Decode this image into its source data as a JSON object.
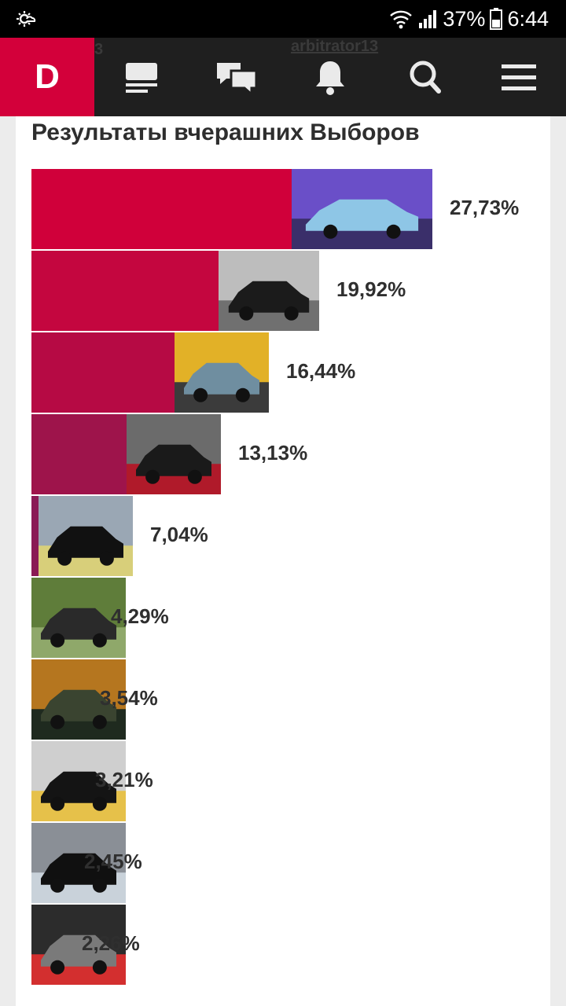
{
  "status_bar": {
    "battery": "37%",
    "time": "6:44"
  },
  "nav": {
    "logo": "D",
    "peek_user": "arbitrator13",
    "peek_num": "3",
    "icons": [
      "feed-icon",
      "messages-icon",
      "bell-icon",
      "search-icon",
      "menu-icon"
    ]
  },
  "chart_data": {
    "type": "bar",
    "orientation": "horizontal",
    "title": "Результаты вчерашних Выборов",
    "categories": [
      "",
      "",
      "",
      "",
      "",
      "",
      "",
      "",
      "",
      ""
    ],
    "values": [
      27.73,
      19.92,
      16.44,
      13.13,
      7.04,
      4.29,
      3.54,
      3.21,
      2.45,
      2.26
    ],
    "labels": [
      "27,73%",
      "19,92%",
      "16,44%",
      "13,13%",
      "7,04%",
      "4,29%",
      "3,54%",
      "3,21%",
      "2,45%",
      "2,26%"
    ],
    "colors": [
      "#d0003a",
      "#c4063f",
      "#b60a44",
      "#9e144b",
      "#8a1a55",
      "#75205e",
      "#602a6a",
      "#4a3378",
      "#33408a",
      "#1f4f96"
    ],
    "photo_palettes": [
      [
        "#6a4fc8",
        "#8ec6e6",
        "#3a2f6a"
      ],
      [
        "#bdbdbd",
        "#1b1b1b",
        "#707070"
      ],
      [
        "#e2b127",
        "#6f8ea0",
        "#3b3b3b"
      ],
      [
        "#6b6b6b",
        "#1a1a1a",
        "#b01a2a"
      ],
      [
        "#9aa7b4",
        "#111111",
        "#d8cf7a"
      ],
      [
        "#5f7d3a",
        "#2a2a2a",
        "#8fa86a"
      ],
      [
        "#b5761f",
        "#3a4430",
        "#1f2a1f"
      ],
      [
        "#cfcfcf",
        "#141414",
        "#e6c14a"
      ],
      [
        "#8a8f96",
        "#101010",
        "#c9d2da"
      ],
      [
        "#2c2c2c",
        "#7a7a7a",
        "#d32f2f"
      ]
    ],
    "xlim": [
      0,
      27.73
    ],
    "grid": false,
    "legend": "none"
  }
}
